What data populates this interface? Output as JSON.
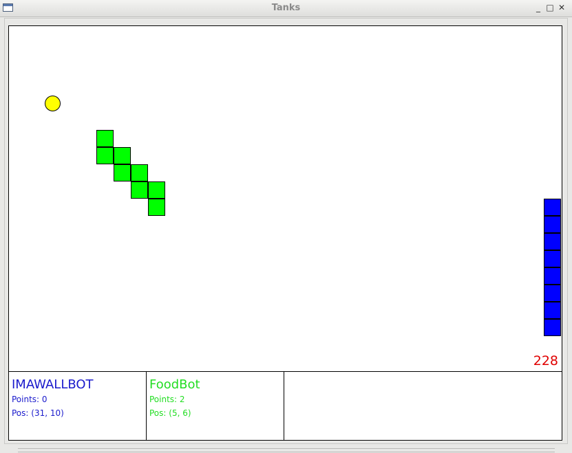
{
  "window": {
    "title": "Tanks",
    "controls": {
      "minimize": "_",
      "maximize": "□",
      "close": "✕"
    }
  },
  "colors": {
    "food": "#ffff00",
    "bot1": "#0000ff",
    "bot2": "#00ff00",
    "counter": "#e00000",
    "bot1_text": "#1a1acc",
    "bot2_text": "#22dd22"
  },
  "board": {
    "cell_size_label": "",
    "food": {
      "col": 2,
      "row": 4,
      "color": "#ffff00"
    },
    "bots": [
      {
        "name": "IMAWALLBOT",
        "color": "#0000ff",
        "cells": [
          [
            31,
            10
          ],
          [
            31,
            11
          ],
          [
            31,
            12
          ],
          [
            31,
            13
          ],
          [
            31,
            14
          ],
          [
            31,
            15
          ],
          [
            31,
            16
          ],
          [
            31,
            17
          ]
        ]
      },
      {
        "name": "FoodBot",
        "color": "#00ff00",
        "cells": [
          [
            5,
            6
          ],
          [
            5,
            7
          ],
          [
            6,
            7
          ],
          [
            6,
            8
          ],
          [
            7,
            8
          ],
          [
            7,
            9
          ],
          [
            8,
            9
          ],
          [
            8,
            10
          ]
        ]
      }
    ],
    "counter": "228"
  },
  "panels": [
    {
      "name": "IMAWALLBOT",
      "points": "Points: 0",
      "pos": "Pos: (31, 10)",
      "color": "#1a1acc"
    },
    {
      "name": "FoodBot",
      "points": "Points: 2",
      "pos": "Pos: (5, 6)",
      "color": "#22dd22"
    }
  ]
}
